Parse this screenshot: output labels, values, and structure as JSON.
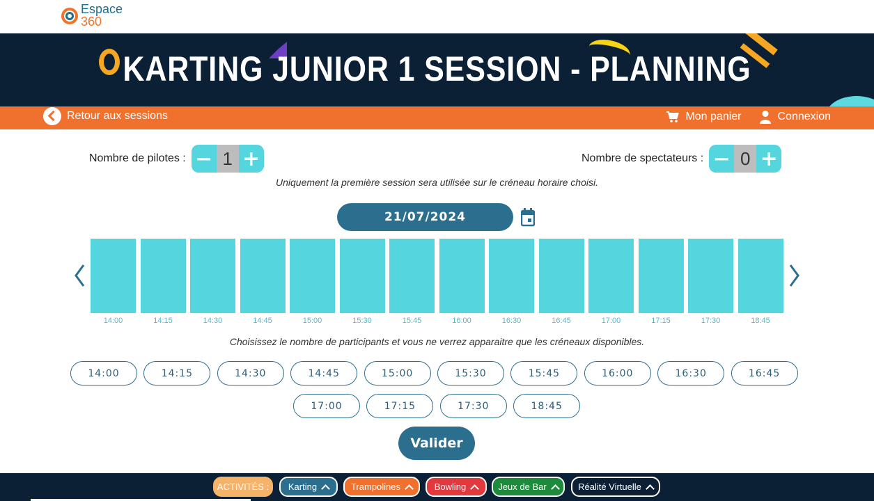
{
  "logo": {
    "line1": "Espace",
    "line2": "360"
  },
  "banner": {
    "title": "KARTING JUNIOR 1 SESSION - PLANNING"
  },
  "nav": {
    "back_label": "Retour aux sessions",
    "cart_label": "Mon panier",
    "login_label": "Connexion"
  },
  "pilots": {
    "label": "Nombre de pilotes :",
    "value": "1",
    "minus": "−",
    "plus": "+"
  },
  "spectators": {
    "label": "Nombre de spectateurs :",
    "value": "0",
    "minus": "−",
    "plus": "+"
  },
  "note_session": "Uniquement la première session sera utilisée sur le créneau horaire choisi.",
  "date": "21/07/2024",
  "slots": [
    "14:00",
    "14:15",
    "14:30",
    "14:45",
    "15:00",
    "15:30",
    "15:45",
    "16:00",
    "16:30",
    "16:45",
    "17:00",
    "17:15",
    "17:30",
    "18:45"
  ],
  "note_participants": "Choisissez le nombre de participants et vous ne verrez apparaitre que les créneaux disponibles.",
  "time_buttons": [
    "14:00",
    "14:15",
    "14:30",
    "14:45",
    "15:00",
    "15:30",
    "15:45",
    "16:00",
    "16:30",
    "16:45",
    "17:00",
    "17:15",
    "17:30",
    "18:45"
  ],
  "validate_label": "Valider",
  "activities": {
    "label": "ACTIVITÉS :",
    "items": [
      {
        "name": "Karting",
        "color": "#2b6e8e"
      },
      {
        "name": "Trampolines",
        "color": "#f0702e"
      },
      {
        "name": "Bowling",
        "color": "#e0393e"
      },
      {
        "name": "Jeux de Bar",
        "color": "#1e8a3c"
      },
      {
        "name": "Réalité Virtuelle",
        "color": "#0b2035"
      }
    ]
  },
  "colors": {
    "accent_teal": "#55d6de",
    "navy": "#0b2035",
    "orange": "#f0702e",
    "blue": "#2b6e8e"
  }
}
